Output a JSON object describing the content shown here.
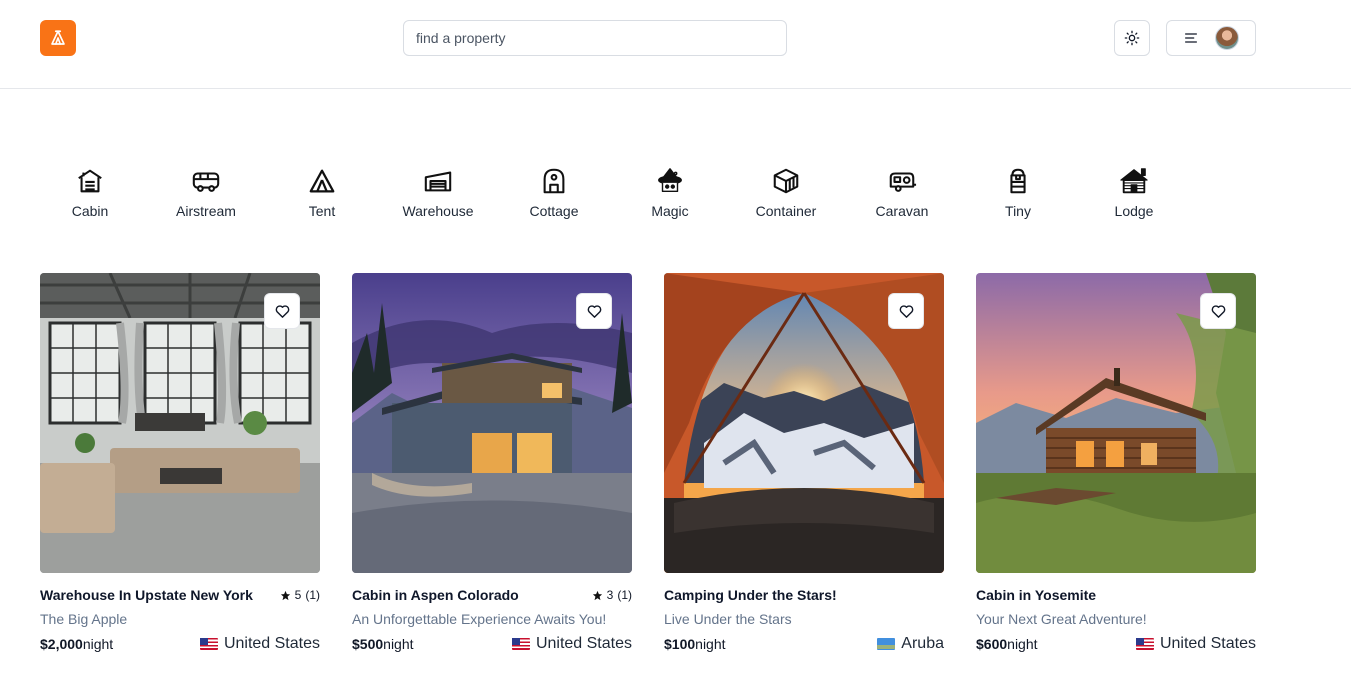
{
  "header": {
    "search_placeholder": "find a property"
  },
  "categories": [
    {
      "label": "Cabin",
      "icon": "cabin-icon"
    },
    {
      "label": "Airstream",
      "icon": "airstream-icon"
    },
    {
      "label": "Tent",
      "icon": "tent-icon"
    },
    {
      "label": "Warehouse",
      "icon": "warehouse-icon"
    },
    {
      "label": "Cottage",
      "icon": "cottage-icon"
    },
    {
      "label": "Magic",
      "icon": "magic-icon"
    },
    {
      "label": "Container",
      "icon": "container-icon"
    },
    {
      "label": "Caravan",
      "icon": "caravan-icon"
    },
    {
      "label": "Tiny",
      "icon": "tiny-icon"
    },
    {
      "label": "Lodge",
      "icon": "lodge-icon"
    }
  ],
  "properties": [
    {
      "title": "Warehouse In Upstate New York",
      "rating": "5",
      "reviews": "(1)",
      "tagline": "The Big Apple",
      "price": "$2,000",
      "unit": "night",
      "country": "United States"
    },
    {
      "title": "Cabin in Aspen Colorado",
      "rating": "3",
      "reviews": "(1)",
      "tagline": "An Unforgettable Experience Awaits You!",
      "price": "$500",
      "unit": "night",
      "country": "United States"
    },
    {
      "title": "Camping Under the Stars!",
      "rating": "",
      "reviews": "",
      "tagline": "Live Under the Stars",
      "price": "$100",
      "unit": "night",
      "country": "Aruba"
    },
    {
      "title": "Cabin in Yosemite",
      "rating": "",
      "reviews": "",
      "tagline": "Your Next Great Adventure!",
      "price": "$600",
      "unit": "night",
      "country": "United States"
    }
  ],
  "colors": {
    "brand": "#f97316",
    "text_muted": "#64748b",
    "border": "#d9dde3"
  }
}
